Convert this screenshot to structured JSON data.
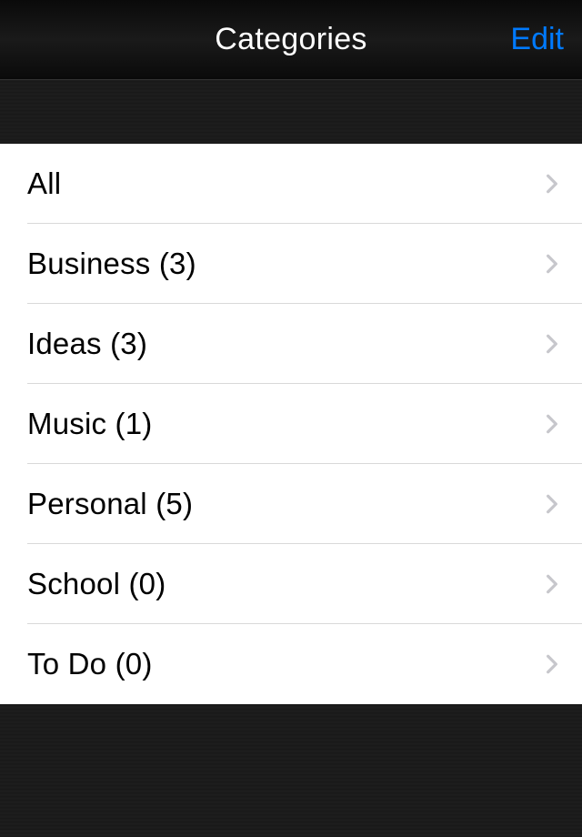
{
  "navbar": {
    "title": "Categories",
    "edit_label": "Edit"
  },
  "categories": [
    {
      "label": "All"
    },
    {
      "label": "Business (3)"
    },
    {
      "label": "Ideas (3)"
    },
    {
      "label": "Music (1)"
    },
    {
      "label": "Personal (5)"
    },
    {
      "label": "School (0)"
    },
    {
      "label": "To Do (0)"
    }
  ],
  "colors": {
    "accent": "#007aff"
  }
}
